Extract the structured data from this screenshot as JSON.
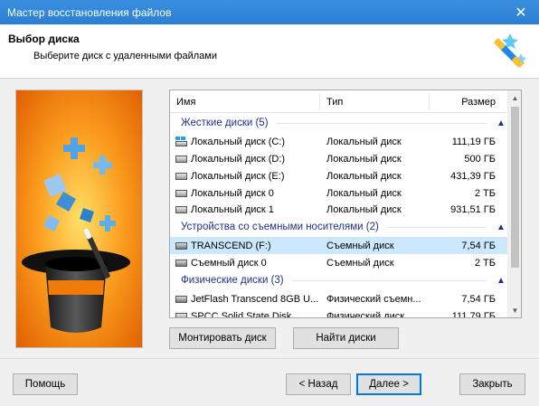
{
  "window": {
    "title": "Мастер восстановления файлов",
    "close_icon": "close-icon"
  },
  "header": {
    "title": "Выбор диска",
    "subtitle": "Выберите диск с удаленными файлами",
    "icon": "magic-wand-icon"
  },
  "disk_list": {
    "columns": {
      "name": "Имя",
      "type": "Тип",
      "size": "Размер"
    },
    "groups": [
      {
        "label": "Жесткие диски (5)",
        "items": [
          {
            "name": "Локальный диск (C:)",
            "type": "Локальный диск",
            "size": "111,19 ГБ",
            "icon": "windows-drive-icon"
          },
          {
            "name": "Локальный диск (D:)",
            "type": "Локальный диск",
            "size": "500 ГБ",
            "icon": "hard-drive-icon"
          },
          {
            "name": "Локальный диск (E:)",
            "type": "Локальный диск",
            "size": "431,39 ГБ",
            "icon": "hard-drive-icon"
          },
          {
            "name": "Локальный диск 0",
            "type": "Локальный диск",
            "size": "2 ТБ",
            "icon": "hard-drive-icon"
          },
          {
            "name": "Локальный диск 1",
            "type": "Локальный диск",
            "size": "931,51 ГБ",
            "icon": "hard-drive-icon"
          }
        ]
      },
      {
        "label": "Устройства со съемными носителями (2)",
        "items": [
          {
            "name": "TRANSCEND (F:)",
            "type": "Съемный диск",
            "size": "7,54 ГБ",
            "icon": "usb-drive-icon",
            "selected": true
          },
          {
            "name": "Съемный диск 0",
            "type": "Съемный диск",
            "size": "2 ТБ",
            "icon": "usb-drive-icon"
          }
        ]
      },
      {
        "label": "Физические диски (3)",
        "items": [
          {
            "name": "JetFlash Transcend 8GB U...",
            "type": "Физический съемн...",
            "size": "7,54 ГБ",
            "icon": "usb-drive-icon"
          },
          {
            "name": "SPCC Solid State Disk",
            "type": "Физический диск",
            "size": "111,79 ГБ",
            "icon": "hard-drive-icon"
          }
        ]
      }
    ]
  },
  "buttons": {
    "mount": "Монтировать диск",
    "find": "Найти диски",
    "help": "Помощь",
    "back": "< Назад",
    "next": "Далее >",
    "close": "Закрыть"
  },
  "colors": {
    "titlebar": "#2b7fd4",
    "group_text": "#1e3287",
    "selected_row": "#cce8ff",
    "side_image_bg": "#f07a0a"
  }
}
